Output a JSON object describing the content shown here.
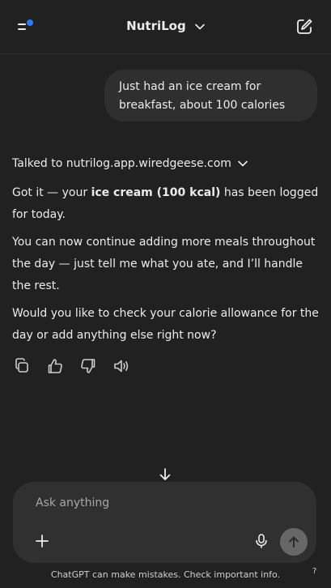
{
  "header": {
    "title": "NutriLog",
    "menu_icon": "sidebar-menu-icon",
    "new_chat_icon": "new-chat-icon",
    "notification_dot_color": "#2f7bf6"
  },
  "messages": {
    "user": "Just had an ice cream for breakfast, about 100 calories",
    "tool_call": "Talked to nutrilog.app.wiredgeese.com",
    "assistant": {
      "p1_before": "Got it — your ",
      "p1_bold": "ice cream (100 kcal)",
      "p1_after": " has been logged for today.",
      "p2": "You can now continue adding more meals throughout the day — just tell me what you ate, and I’ll handle the rest.",
      "p3": "Would you like to check your calorie allowance for the day or add anything else right now?"
    },
    "actions": [
      "copy-icon",
      "thumbs-up-icon",
      "thumbs-down-icon",
      "read-aloud-icon"
    ]
  },
  "composer": {
    "placeholder": "Ask anything"
  },
  "footer": {
    "disclaimer": "ChatGPT can make mistakes. Check important info.",
    "help": "?"
  }
}
